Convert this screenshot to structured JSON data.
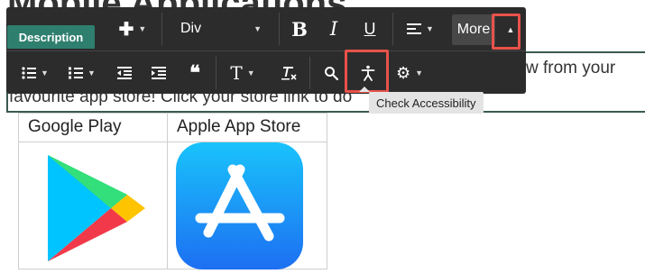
{
  "page": {
    "heading": "Mobile Applications",
    "description_tab": "Description",
    "body_line1_end": "w from your",
    "body_line2": "favourite app store! Click your store link to do"
  },
  "toolbar": {
    "row1": {
      "insert_label": "✚",
      "block_format": "Div",
      "bold": "B",
      "italic": "I",
      "underline": "U",
      "more_label": "More"
    },
    "row2": {
      "quote_label": "❝"
    }
  },
  "tooltip": {
    "text": "Check Accessibility"
  },
  "table": {
    "headers": [
      "Google Play",
      "Apple App Store"
    ]
  },
  "colors": {
    "toolbar_bg": "#2c2c2c",
    "tab_green": "#2f7f6f",
    "highlight_red": "#e8524a",
    "appstore_blue": "#1a8cff"
  }
}
